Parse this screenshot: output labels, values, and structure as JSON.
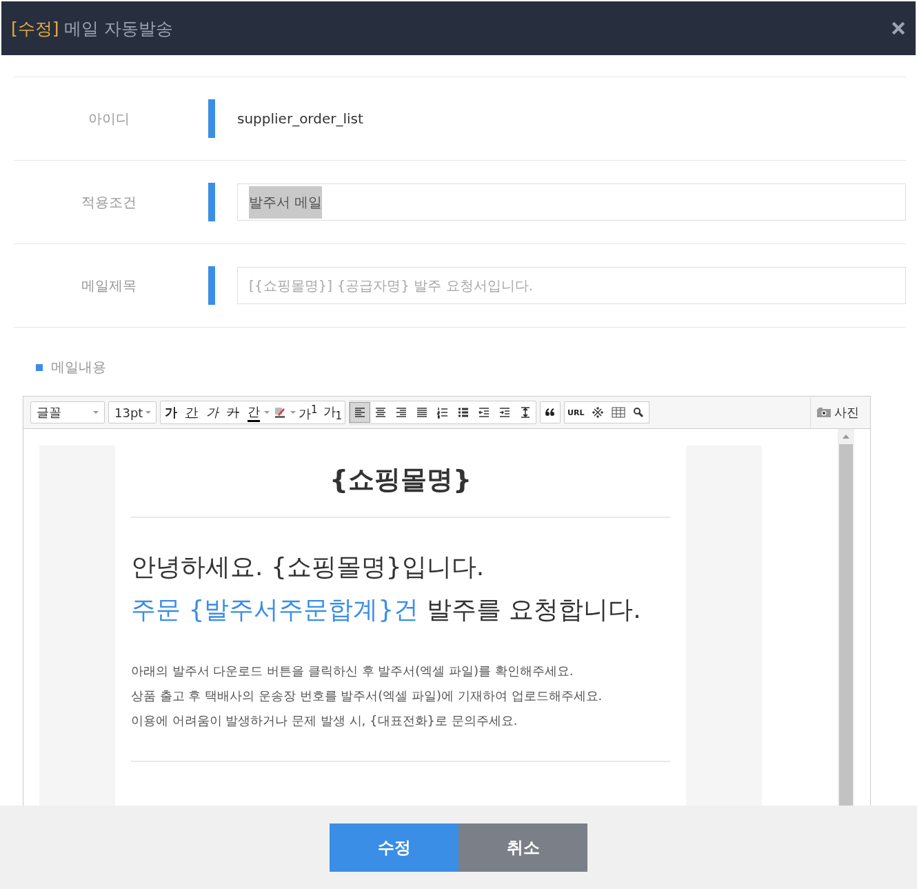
{
  "window": {
    "title_tag": "[수정]",
    "title": "메일 자동발송"
  },
  "form": [
    {
      "label": "아이디",
      "kind": "text",
      "value": "supplier_order_list"
    },
    {
      "label": "적용조건",
      "kind": "select-text",
      "value": "발주서 메일"
    },
    {
      "label": "메일제목",
      "kind": "input",
      "placeholder": "[{쇼핑몰명}] {공급자명} 발주 요청서입니다."
    }
  ],
  "section_title": "메일내용",
  "editor": {
    "toolbar": [
      {
        "kind": "font",
        "label": "글꼴"
      },
      {
        "kind": "size",
        "label": "13pt"
      }
    ],
    "format_buttons": [
      {
        "kind": "bold",
        "label": "가"
      },
      {
        "kind": "underline",
        "label": "간"
      },
      {
        "kind": "italic",
        "label": "가"
      },
      {
        "kind": "strike",
        "label": "가"
      },
      {
        "kind": "color",
        "label": "간"
      },
      {
        "kind": "highlight"
      },
      {
        "kind": "sup",
        "label": "가$^{1}$"
      },
      {
        "kind": "sub",
        "label": "가$_{1}$"
      }
    ],
    "align_buttons": [
      {
        "kind": "left",
        "selected": true
      },
      {
        "kind": "center",
        "selected": false
      },
      {
        "kind": "right",
        "selected": false
      },
      {
        "kind": "justify",
        "selected": false
      },
      {
        "kind": "ordered",
        "selected": false
      },
      {
        "kind": "bullet",
        "selected": false
      },
      {
        "kind": "outdent",
        "selected": false
      },
      {
        "kind": "indent",
        "selected": false
      },
      {
        "kind": "lineheight",
        "selected": false
      }
    ],
    "insert_buttons": [
      {
        "kind": "quote"
      },
      {
        "kind": "url",
        "label": "URL"
      },
      {
        "kind": "special"
      },
      {
        "kind": "table"
      },
      {
        "kind": "find"
      }
    ],
    "photo_label": "사진",
    "heading": "{쇼핑몰명}",
    "greeting": [
      {
        "text": "안녕하세요. {쇼핑몰명}입니다.",
        "highlight": false
      }
    ],
    "request": [
      {
        "text": "주문 {발주서주문합계}건",
        "highlight": true
      },
      {
        "text": " 발주를 요청합니다.",
        "highlight": false
      }
    ],
    "paragraphs": [
      "아래의 발주서 다운로드 버튼을 클릭하신 후 발주서(엑셀 파일)를 확인해주세요.",
      "상품 출고 후 택배사의 운송장 번호를 발주서(엑셀 파일)에 기재하여 업로드해주세요.",
      "이용에 어려움이 발생하거나 문제 발생 시, {대표전화}로 문의주세요."
    ]
  },
  "buttons": [
    {
      "label": "수정",
      "kind": "primary"
    },
    {
      "label": "취소",
      "kind": "secondary"
    }
  ]
}
